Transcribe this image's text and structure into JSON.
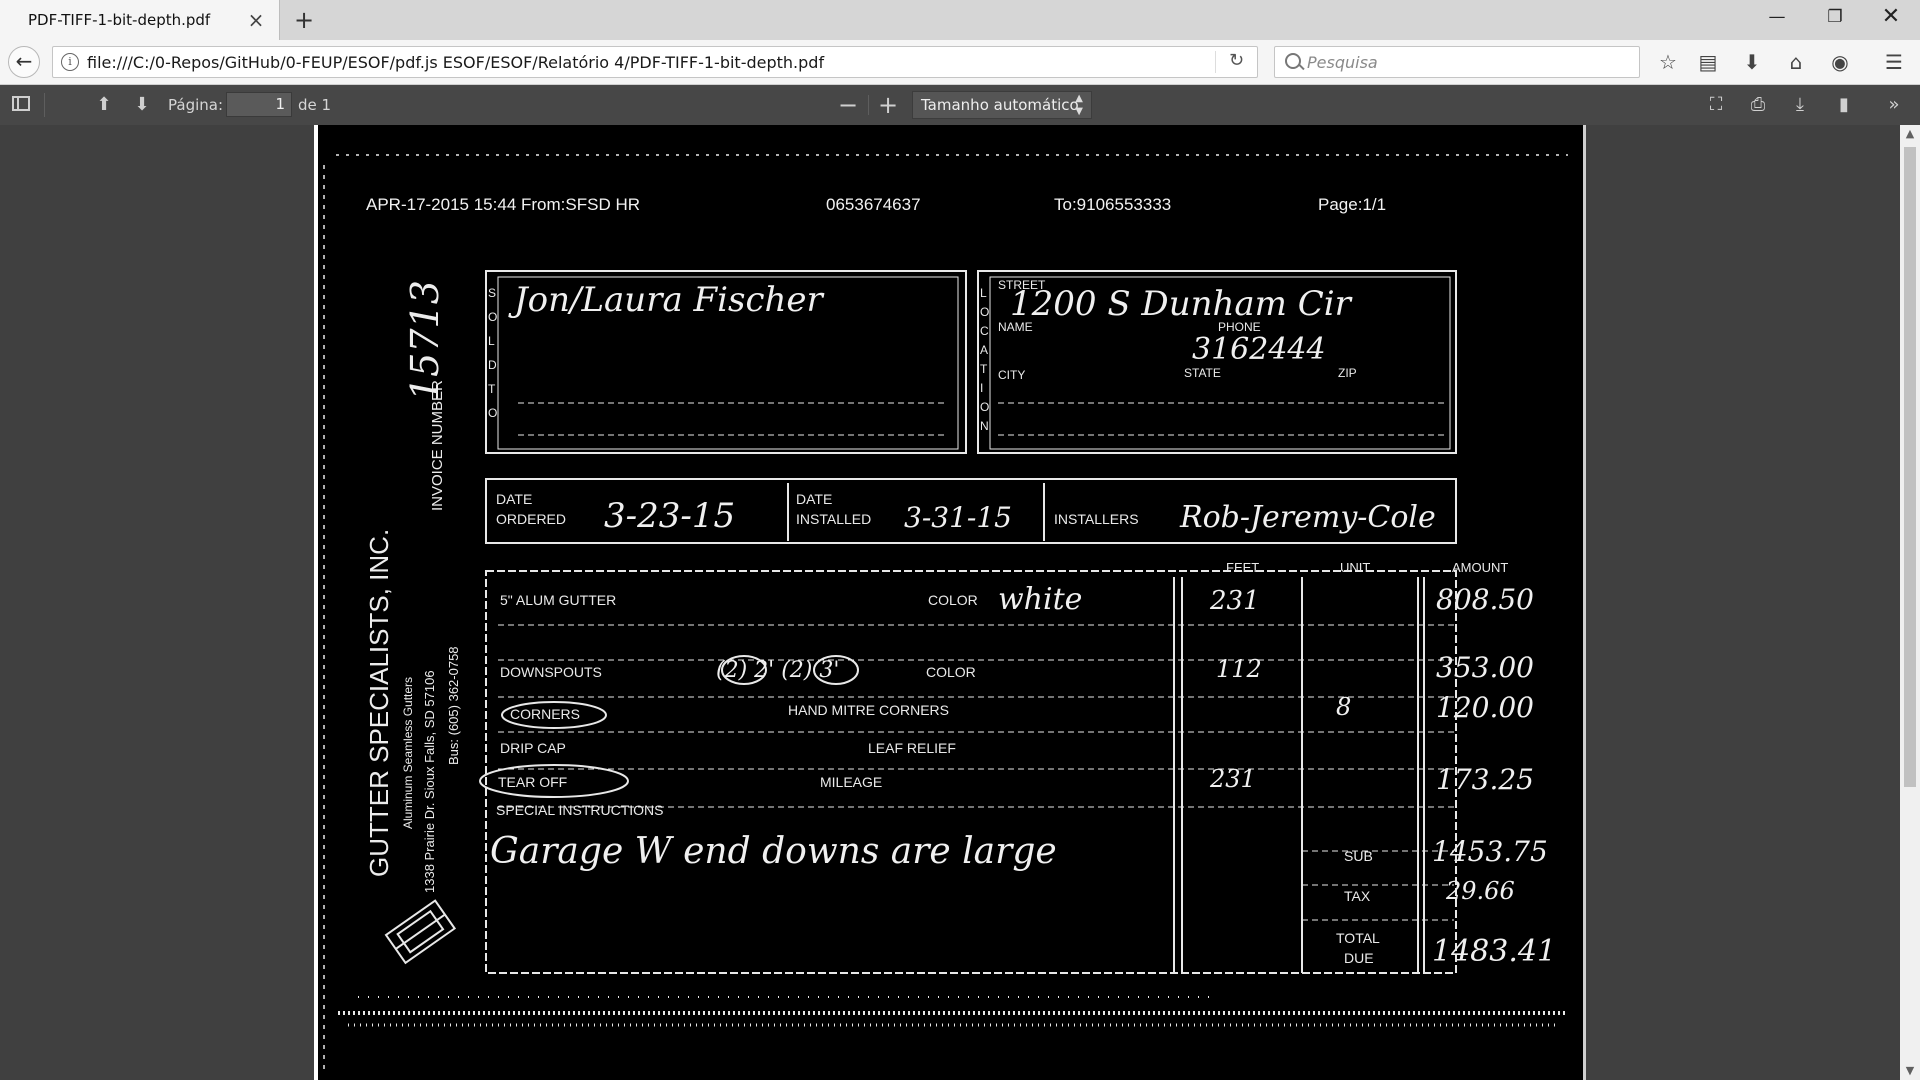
{
  "browser": {
    "tab_title": "PDF-TIFF-1-bit-depth.pdf",
    "tab_close": "×",
    "new_tab": "+",
    "url": "file:///C:/0-Repos/GitHub/0-FEUP/ESOF/pdf.js ESOF/ESOF/Relatório 4/PDF-TIFF-1-bit-depth.pdf",
    "search_placeholder": "Pesquisa"
  },
  "pdf_toolbar": {
    "page_label": "Página:",
    "page_value": "1",
    "page_of": "de 1",
    "zoom_value": "Tamanho automático"
  },
  "document": {
    "header": {
      "left": "APR-17-2015 15:44 From:SFSD HR",
      "middle": "0653674637",
      "right": "To:9106553333",
      "page": "Page:1/1"
    },
    "sold_to_letters": [
      "S",
      "O",
      "L",
      "D",
      "T",
      "O"
    ],
    "sold_to_name": "Jon/Laura Fischer",
    "location_letters": [
      "L",
      "O",
      "C",
      "A",
      "T",
      "I",
      "O",
      "N"
    ],
    "location": {
      "street_label": "STREET",
      "street_value": "1200 S Dunham Cir",
      "name_label": "NAME",
      "phone_label": "PHONE",
      "phone_value": "3162444",
      "city_label": "CITY",
      "state_label": "STATE",
      "zip_label": "ZIP"
    },
    "dates": {
      "ordered_label_1": "DATE",
      "ordered_label_2": "ORDERED",
      "ordered_value": "3-23-15",
      "installed_label_1": "DATE",
      "installed_label_2": "INSTALLED",
      "installed_value": "3-31-15",
      "installers_label": "INSTALLERS",
      "installers_value": "Rob-Jeremy-Cole"
    },
    "columns": {
      "feet": "FEET",
      "unit": "UNIT",
      "amount": "AMOUNT"
    },
    "items": {
      "gutter_label": "5\" ALUM GUTTER",
      "color_label": "COLOR",
      "color_value": "white",
      "gutter_feet": "231",
      "gutter_amount": "808.50",
      "downspouts_label": "DOWNSPOUTS",
      "downspouts_note": "(2) 2' (2) 3'",
      "downspouts_color": "COLOR",
      "downspouts_feet": "112",
      "downspouts_amount": "353.00",
      "corners_label": "CORNERS",
      "hand_miter": "HAND MITRE CORNERS",
      "corners_unit": "8",
      "corners_amount": "120.00",
      "drip_cap": "DRIP CAP",
      "leaf_relief": "LEAF RELIEF",
      "tear_off": "TEAR OFF",
      "mileage": "MILEAGE",
      "tear_off_feet": "231",
      "tear_off_amount": "173.25",
      "special_instructions": "SPECIAL INSTRUCTIONS",
      "instructions_text": "Garage W end downs are large"
    },
    "totals": {
      "sub_label": "SUB",
      "sub_value": "1453.75",
      "tax_label": "TAX",
      "tax_value": "29.66",
      "total_label_1": "TOTAL",
      "total_label_2": "DUE",
      "total_value": "1483.41"
    },
    "side_company": "GUTTER SPECIALISTS, INC.",
    "side_address": "Aluminum Seamless Gutters",
    "side_line_3": "1338 Prairie Dr. Sioux Falls, SD 57106",
    "side_line_4": "Bus: (605) 362-0758",
    "side_invoice_label": "INVOICE NUMBER",
    "side_invoice_number": "15713"
  }
}
